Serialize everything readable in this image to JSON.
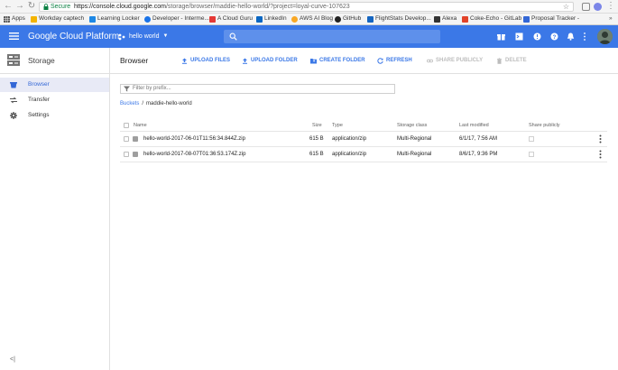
{
  "browser": {
    "secure_label": "Secure",
    "url_host": "https://console.cloud.google.com",
    "url_path": "/storage/browser/maddie-hello-world/?project=loyal-curve-107623",
    "bookmarks": [
      {
        "label": "Apps",
        "color": "#4285f4"
      },
      {
        "label": "Workday captech",
        "color": "#f4b400"
      },
      {
        "label": "Learning Locker",
        "color": "#1e88e5"
      },
      {
        "label": "Developer - Interme...",
        "color": "#1a73e8"
      },
      {
        "label": "A Cloud Guru",
        "color": "#e53935"
      },
      {
        "label": "LinkedIn",
        "color": "#0a66c2"
      },
      {
        "label": "AWS AI Blog",
        "color": "#f9a825"
      },
      {
        "label": "GitHub",
        "color": "#222222"
      },
      {
        "label": "FlightStats Develop...",
        "color": "#1565c0"
      },
      {
        "label": "Alexa",
        "color": "#333333"
      },
      {
        "label": "Coke-Echo - GitLab",
        "color": "#e24329"
      },
      {
        "label": "Proposal Tracker -",
        "color": "#3367d6"
      }
    ]
  },
  "header": {
    "product": "Google Cloud Platform",
    "project": "hello world",
    "brand_color": "#3b78e7"
  },
  "sidebar": {
    "title": "Storage",
    "items": [
      {
        "label": "Browser",
        "icon": "bucket-icon",
        "active": true
      },
      {
        "label": "Transfer",
        "icon": "transfer-icon",
        "active": false
      },
      {
        "label": "Settings",
        "icon": "gear-icon",
        "active": false
      }
    ],
    "collapse_glyph": "<|"
  },
  "main": {
    "title": "Browser",
    "actions": {
      "upload_files": "UPLOAD FILES",
      "upload_folder": "UPLOAD FOLDER",
      "create_folder": "CREATE FOLDER",
      "refresh": "REFRESH",
      "share_publicly": "SHARE PUBLICLY",
      "delete": "DELETE"
    },
    "filter_placeholder": "Filter by prefix...",
    "breadcrumb": {
      "root": "Buckets",
      "separator": "/",
      "bucket": "maddie-hello-world"
    },
    "table": {
      "columns": {
        "name": "Name",
        "size": "Size",
        "type": "Type",
        "storage_class": "Storage class",
        "last_modified": "Last modified",
        "share_publicly": "Share publicly"
      },
      "rows": [
        {
          "name": "hello-world-2017-06-01T11:56:34.844Z.zip",
          "size": "615 B",
          "type": "application/zip",
          "storage_class": "Multi-Regional",
          "last_modified": "6/1/17, 7:56 AM"
        },
        {
          "name": "hello-world-2017-08-07T01:36:53.174Z.zip",
          "size": "615 B",
          "type": "application/zip",
          "storage_class": "Multi-Regional",
          "last_modified": "8/6/17, 9:36 PM"
        }
      ]
    }
  }
}
